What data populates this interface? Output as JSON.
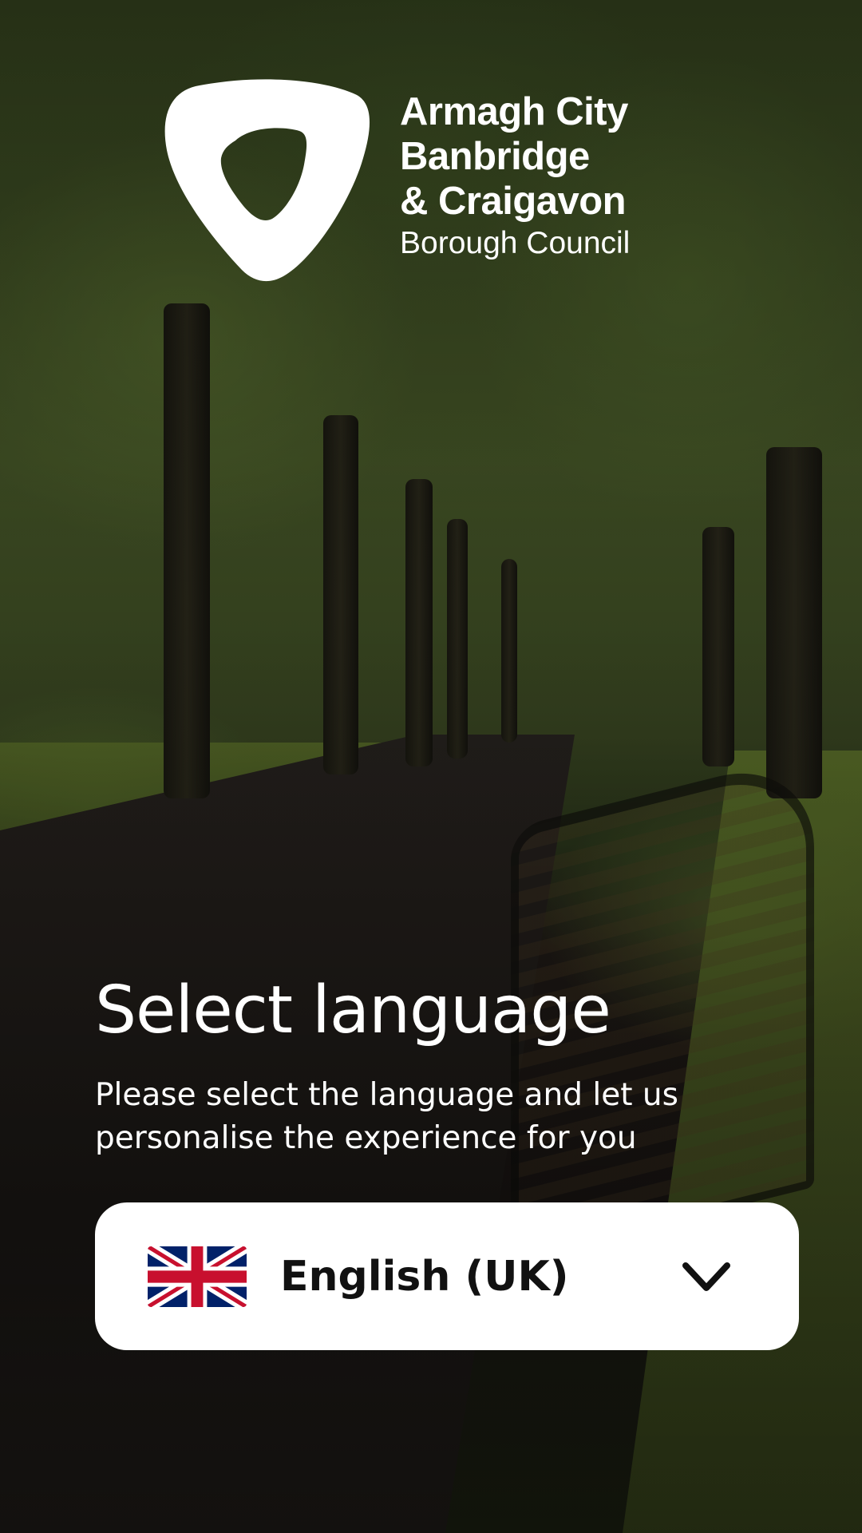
{
  "branding": {
    "logo_icon": "council-logo-icon",
    "name_lines": [
      "Armagh City",
      "Banbridge",
      "& Craigavon"
    ],
    "subtitle": "Borough Council"
  },
  "language_screen": {
    "title": "Select language",
    "description": "Please select the language and let us personalise the experience for you",
    "selector": {
      "flag_icon": "uk-flag-icon",
      "selected_value": "English (UK)",
      "chevron_icon": "chevron-down-icon"
    }
  },
  "colors": {
    "text_on_background": "#ffffff",
    "selector_background": "#ffffff",
    "selector_text": "#111111"
  }
}
